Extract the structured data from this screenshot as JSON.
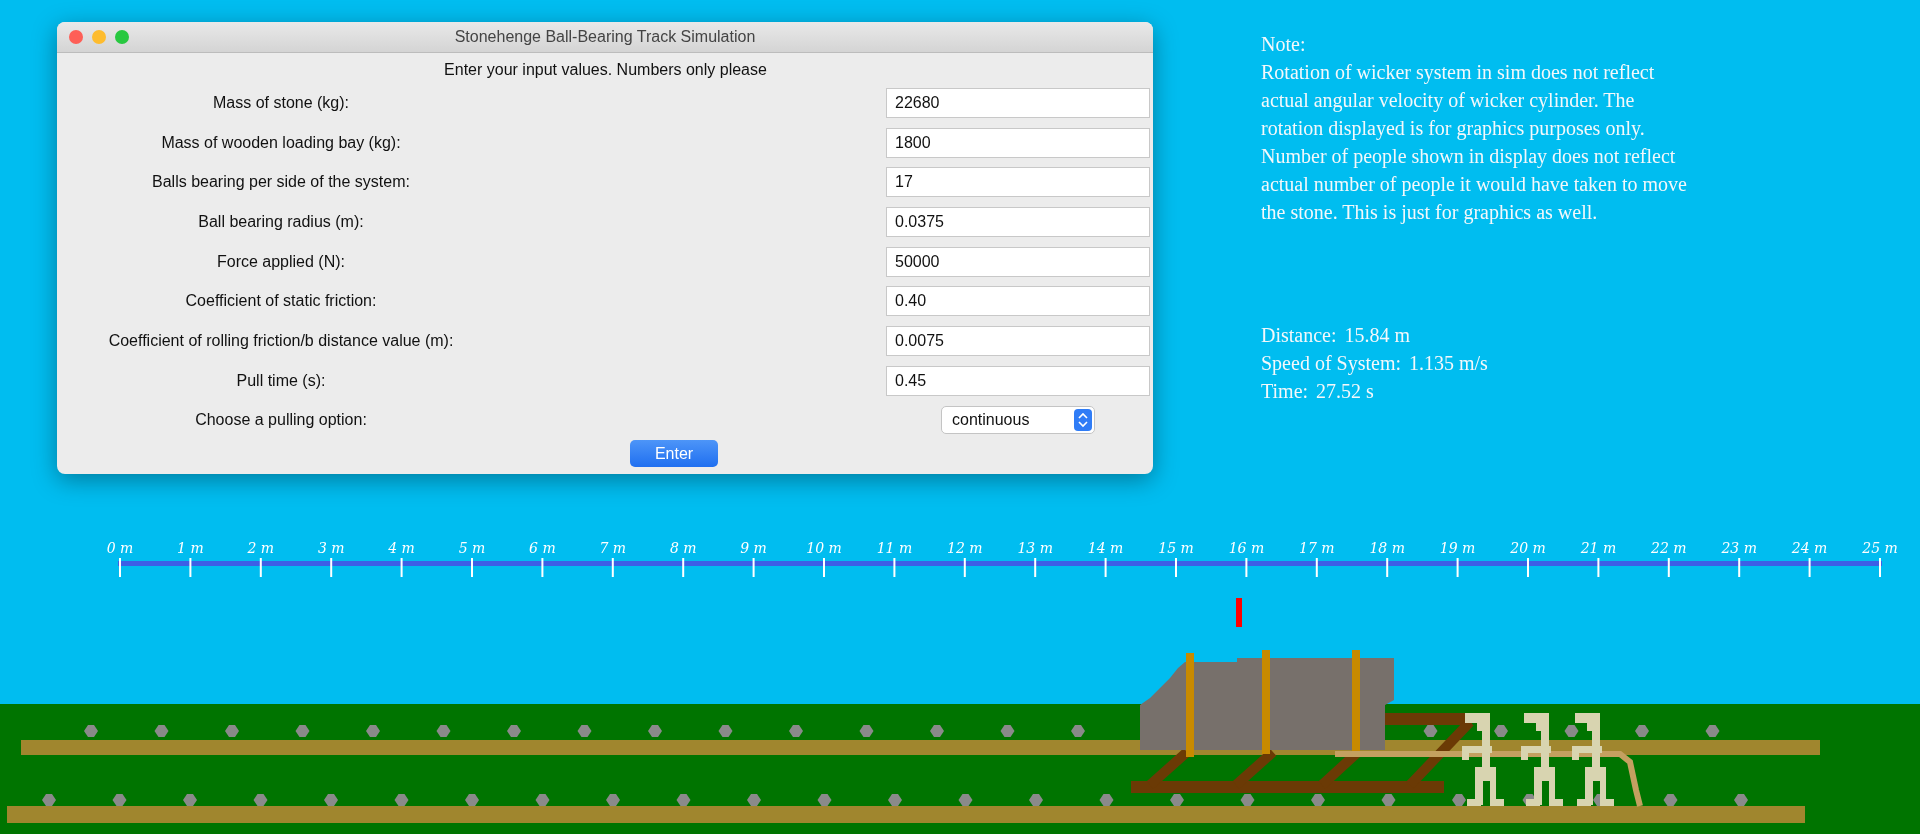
{
  "window": {
    "title": "Stonehenge Ball-Bearing Track Simulation"
  },
  "instruction": "Enter your input values. Numbers only please",
  "fields": [
    {
      "label": "Mass of stone (kg):",
      "value": "22680"
    },
    {
      "label": "Mass of wooden loading bay (kg):",
      "value": "1800"
    },
    {
      "label": "Balls bearing per side of the system:",
      "value": "17"
    },
    {
      "label": "Ball bearing radius (m):",
      "value": "0.0375"
    },
    {
      "label": "Force applied (N):",
      "value": "50000"
    },
    {
      "label": "Coefficient of static friction:",
      "value": "0.40"
    },
    {
      "label": "Coefficient of rolling friction/b distance value (m):",
      "value": "0.0075"
    },
    {
      "label": "Pull time (s):",
      "value": "0.45"
    }
  ],
  "pulling_option": {
    "label": "Choose a pulling option:",
    "value": "continuous"
  },
  "enter_button": "Enter",
  "note": {
    "title": "Note:",
    "text": "Rotation of wicker system in sim does not reflect\nactual angular velocity of wicker cylinder. The\nrotation displayed is for graphics purposes only.\nNumber of people shown in display does not reflect\nactual number of people it would have taken to move\nthe stone. This is just for graphics as well."
  },
  "stats": [
    {
      "label": "Distance:",
      "value": "15.84 m"
    },
    {
      "label": "Speed of System:",
      "value": "1.135 m/s"
    },
    {
      "label": "Time:",
      "value": "27.52 s"
    }
  ],
  "ruler": {
    "labels": [
      "0 m",
      "1 m",
      "2 m",
      "3 m",
      "4 m",
      "5 m",
      "6 m",
      "7 m",
      "8 m",
      "9 m",
      "10 m",
      "11 m",
      "12 m",
      "13 m",
      "14 m",
      "15 m",
      "16 m",
      "17 m",
      "18 m",
      "19 m",
      "20 m",
      "21 m",
      "22 m",
      "23 m",
      "24 m",
      "25 m"
    ]
  }
}
